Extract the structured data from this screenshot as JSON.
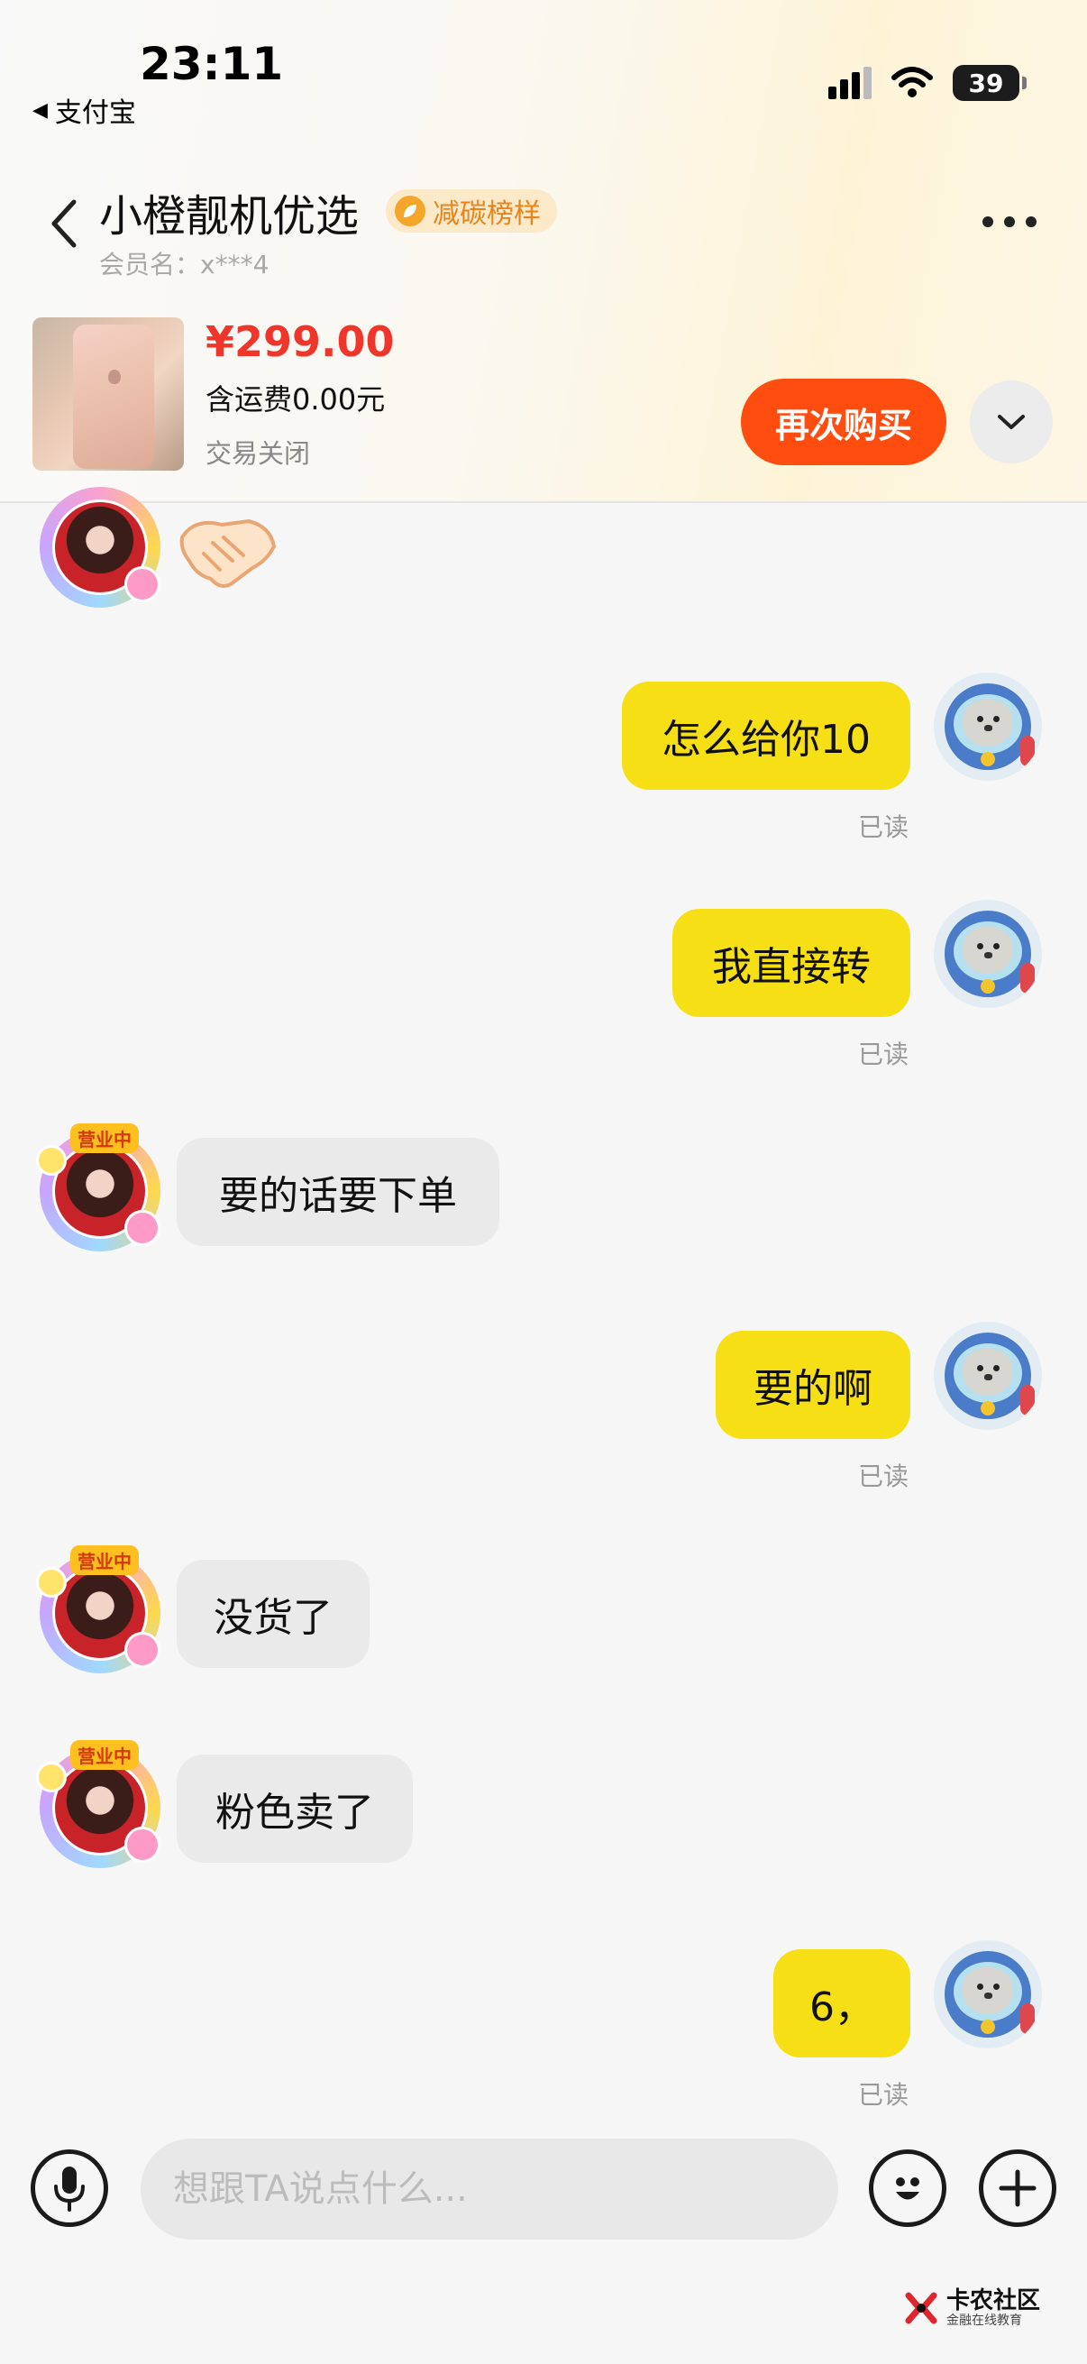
{
  "status_bar": {
    "time": "23:11",
    "back_app": "支付宝",
    "battery": "39"
  },
  "header": {
    "shop_name": "小橙靓机优选",
    "badge": "减碳榜样",
    "member": "会员名：x***4"
  },
  "order": {
    "price": "¥299.00",
    "shipping": "含运费0.00元",
    "status": "交易关闭",
    "rebuy_label": "再次购买"
  },
  "seller_tag": "营业中",
  "messages": [
    {
      "from": "me",
      "text": "怎么给你10",
      "read": "已读"
    },
    {
      "from": "me",
      "text": "我直接转",
      "read": "已读"
    },
    {
      "from": "them",
      "text": "要的话要下单"
    },
    {
      "from": "me",
      "text": "要的啊",
      "read": "已读"
    },
    {
      "from": "them",
      "text": "没货了"
    },
    {
      "from": "them",
      "text": "粉色卖了"
    },
    {
      "from": "me",
      "text": "6，",
      "read": "已读"
    }
  ],
  "input": {
    "placeholder": "想跟TA说点什么..."
  },
  "watermark": {
    "title": "卡农社区",
    "subtitle": "金融在线教育"
  },
  "colors": {
    "accent": "#ff4d0f",
    "price": "#f0352a",
    "my_bubble": "#f7df16",
    "their_bubble": "#eaeaea"
  }
}
